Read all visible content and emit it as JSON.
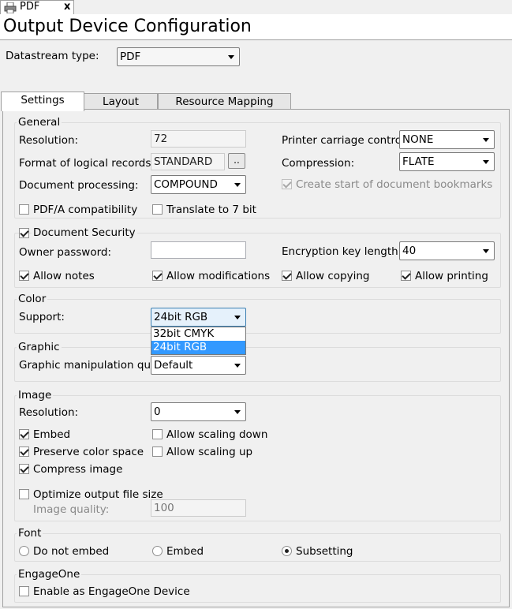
{
  "doc_tab": {
    "label": "PDF",
    "close": "x"
  },
  "page_title": "Output Device Configuration",
  "datastream": {
    "label": "Datastream type:",
    "value": "PDF"
  },
  "tabs": [
    {
      "label": "Settings"
    },
    {
      "label": "Layout"
    },
    {
      "label": "Resource Mapping"
    }
  ],
  "general": {
    "title": "General",
    "resolution_label": "Resolution:",
    "resolution_value": "72",
    "format_label": "Format of logical records:",
    "format_value": "STANDARD",
    "browse_label": "..",
    "docproc_label": "Document processing:",
    "docproc_value": "COMPOUND",
    "carriage_label": "Printer carriage control:",
    "carriage_value": "NONE",
    "compression_label": "Compression:",
    "compression_value": "FLATE",
    "bookmarks_label": "Create start of document bookmarks",
    "pdfa_label": "PDF/A compatibility",
    "translate_label": "Translate to 7 bit"
  },
  "security": {
    "title": "Document Security",
    "owner_label": "Owner password:",
    "owner_value": "",
    "enc_label": "Encryption key length:",
    "enc_value": "40",
    "notes_label": "Allow notes",
    "mods_label": "Allow modifications",
    "copy_label": "Allow copying",
    "print_label": "Allow printing"
  },
  "color": {
    "title": "Color",
    "support_label": "Support:",
    "support_value": "24bit RGB",
    "options": [
      "32bit CMYK",
      "24bit RGB"
    ]
  },
  "graphic": {
    "title": "Graphic",
    "manip_label": "Graphic manipulation qual",
    "manip_value": "Default"
  },
  "image": {
    "title": "Image",
    "resolution_label": "Resolution:",
    "resolution_value": "0",
    "embed_label": "Embed",
    "preserve_label": "Preserve color space",
    "compress_label": "Compress image",
    "scale_down_label": "Allow scaling down",
    "scale_up_label": "Allow scaling up",
    "optimize_label": "Optimize output file size",
    "quality_label": "Image quality:",
    "quality_value": "100"
  },
  "font": {
    "title": "Font",
    "not_embed_label": "Do not embed",
    "embed_label": "Embed",
    "subsetting_label": "Subsetting"
  },
  "engageone": {
    "title": "EngageOne",
    "enable_label": "Enable as EngageOne Device"
  }
}
